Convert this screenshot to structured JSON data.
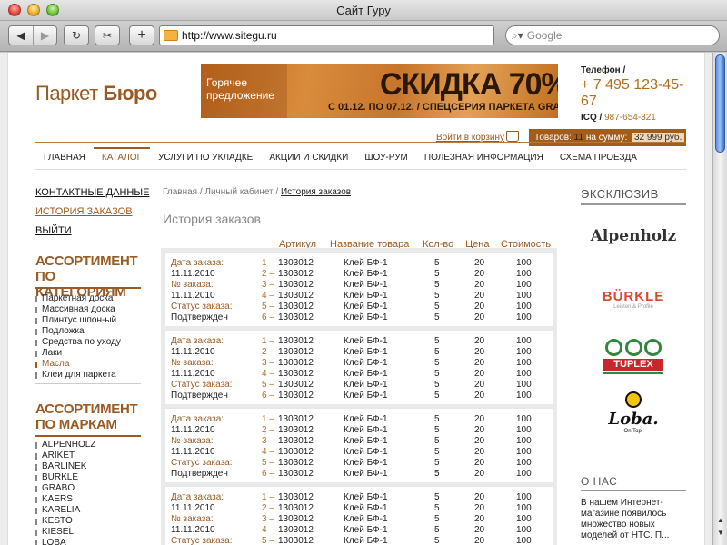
{
  "browser": {
    "window_title": "Сайт Гуру",
    "url": "http://www.sitegu.ru",
    "search_placeholder": "Google"
  },
  "header": {
    "logo_regular": "Паркет",
    "logo_bold": "Бюро",
    "banner": {
      "small_line1": "Горячее",
      "small_line2": "предложение",
      "big": "СКИДКА 70%",
      "sub": "С 01.12. ПО 07.12. / СПЕЦСЕРИЯ ПАРКЕТА GRABO"
    },
    "phone_label": "Телефон /",
    "phone": "+ 7 495 123-45-67",
    "icq_label": "ICQ /",
    "icq": "987-654-321",
    "cart_link": "Войти в корзину",
    "cart_goods_label": "Товаров:",
    "cart_count": "11",
    "cart_sum_label": "на сумму:",
    "cart_sum": "32 999 руб."
  },
  "nav": [
    "ГЛАВНАЯ",
    "КАТАЛОГ",
    "УСЛУГИ ПО УКЛАДКЕ",
    "АКЦИИ И СКИДКИ",
    "ШОУ-РУМ",
    "ПОЛЕЗНАЯ ИНФОРМАЦИЯ",
    "СХЕМА ПРОЕЗДА"
  ],
  "nav_active_index": 1,
  "sidebar": {
    "links": [
      "КОНТАКТНЫЕ ДАННЫЕ",
      "ИСТОРИЯ ЗАКАЗОВ",
      "ВЫЙТИ"
    ],
    "active_link_index": 1,
    "categories_title": [
      "АССОРТИМЕНТ",
      "ПО КАТЕГОРИЯМ"
    ],
    "categories": [
      "Паркетная доска",
      "Массивная доска",
      "Плинтус шпон-ый",
      "Подложка",
      "Средства по уходу",
      "Лаки",
      "Масла",
      "Клеи для паркета"
    ],
    "active_category_index": 6,
    "brands_title": [
      "АССОРТИМЕНТ",
      "ПО МАРКАМ"
    ],
    "brands": [
      "ALPENHOLZ",
      "ARIKET",
      "BARLINEK",
      "BURKLE",
      "GRABO",
      "KAERS",
      "KARELIA",
      "KESTO",
      "KIESEL",
      "LOBA"
    ]
  },
  "breadcrumbs": {
    "home": "Главная",
    "cabinet": "Личный кабинет",
    "current": "История заказов",
    "sep": "/"
  },
  "page_title": "История заказов",
  "table": {
    "headers": {
      "article": "Артикул",
      "name": "Название товара",
      "qty": "Кол-во",
      "price": "Цена",
      "cost": "Стоимость"
    },
    "order_labels": [
      "Дата заказа:",
      "11.11.2010",
      "№ заказа:",
      "11.11.2010",
      "Статус заказа:",
      "Подтвержден"
    ],
    "items": [
      {
        "num": "1 –",
        "article": "1303012",
        "name": "Клей БФ-1",
        "qty": "5",
        "price": "20",
        "cost": "100"
      },
      {
        "num": "2 –",
        "article": "1303012",
        "name": "Клей БФ-1",
        "qty": "5",
        "price": "20",
        "cost": "100"
      },
      {
        "num": "3 –",
        "article": "1303012",
        "name": "Клей БФ-1",
        "qty": "5",
        "price": "20",
        "cost": "100"
      },
      {
        "num": "4 –",
        "article": "1303012",
        "name": "Клей БФ-1",
        "qty": "5",
        "price": "20",
        "cost": "100"
      },
      {
        "num": "5 –",
        "article": "1303012",
        "name": "Клей БФ-1",
        "qty": "5",
        "price": "20",
        "cost": "100"
      },
      {
        "num": "6 –",
        "article": "1303012",
        "name": "Клей БФ-1",
        "qty": "5",
        "price": "20",
        "cost": "100"
      }
    ],
    "orders_count": 4
  },
  "right": {
    "exclusive_title": "ЭКСКЛЮЗИВ",
    "brands": {
      "alpenholz": "Alpenholz",
      "burkle": "BÜRKLE",
      "burkle_sub": "Leisten & Profile",
      "tuplex": "TUPLEX",
      "loba": "Loba.",
      "loba_sub": "On Top!"
    },
    "about_title": "О НАС",
    "about_text": "В нашем Интернет-магазине появилось множество новых моделей от НТС. П..."
  },
  "colors": {
    "accent": "#9a5b25",
    "accent_light": "#b36d1f",
    "scroll_thumb": "#5d8ee0"
  }
}
